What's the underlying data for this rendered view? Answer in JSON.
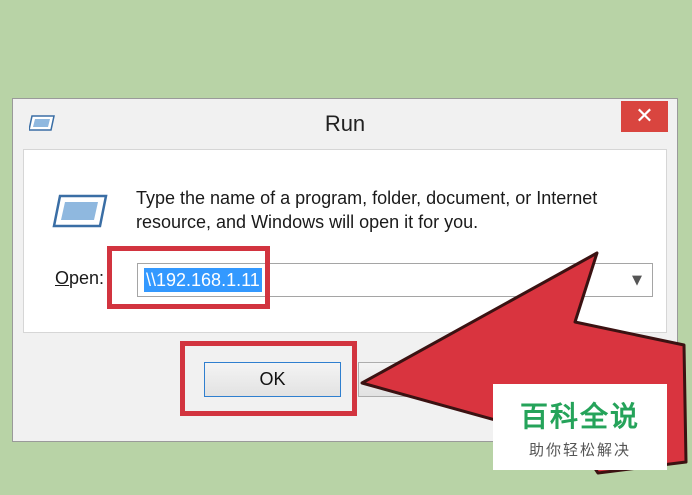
{
  "dialog": {
    "title": "Run",
    "close_label": "✕",
    "title_icon": "run-icon",
    "message": "Type the name of a program, folder, document, or Internet resource, and Windows will open it for you.",
    "open_label": {
      "mnemonic": "O",
      "rest": "pen:"
    },
    "open_value": "\\\\192.168.1.11",
    "dropdown_icon": "chevron-down-icon",
    "ok_label": "OK"
  },
  "watermark": {
    "title": "百科全说",
    "subtitle": "助你轻松解决"
  },
  "colors": {
    "background": "#b8d3a6",
    "highlight": "#d2343f",
    "arrow": "#d9343f",
    "selection": "#3399ff",
    "watermark_green": "#25a35a"
  }
}
